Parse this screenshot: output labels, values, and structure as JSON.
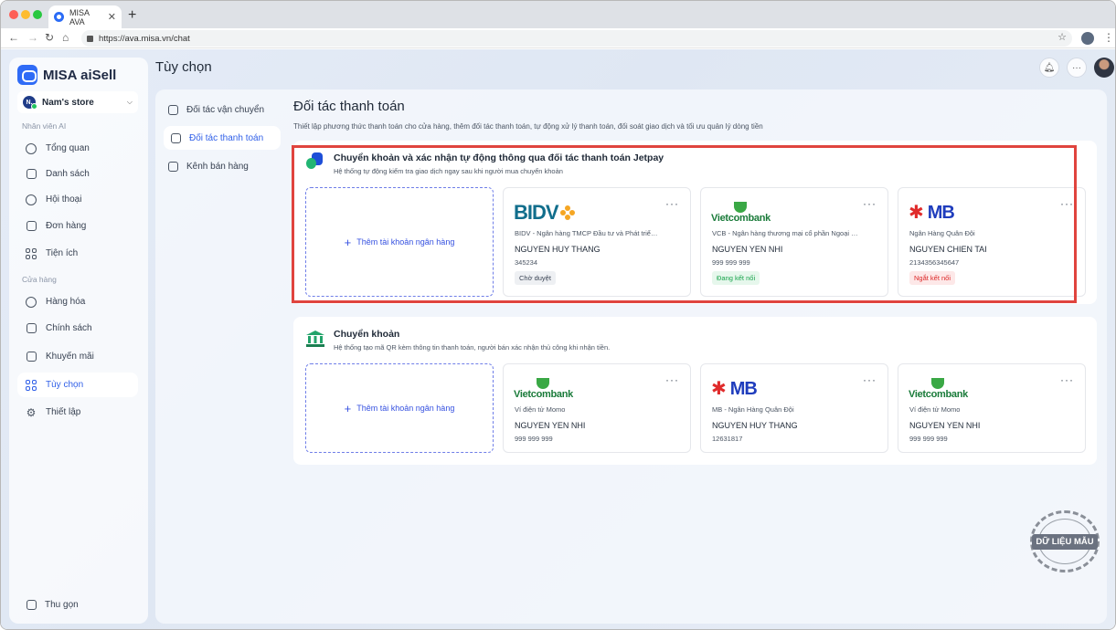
{
  "browser": {
    "tab_title": "MISA AVA",
    "tab_close": "✕",
    "new_tab": "+",
    "url": "https://ava.misa.vn/chat"
  },
  "brand": {
    "name": "MISA aiSell",
    "accent": "#2f6bf6"
  },
  "store": {
    "badge": "N.",
    "name": "Nam's store"
  },
  "sidebar": {
    "section_ai": "Nhân viên AI",
    "section_store": "Cửa hàng",
    "items": [
      {
        "label": "Tổng quan",
        "icon": "pie-chart-icon"
      },
      {
        "label": "Danh sách",
        "icon": "contacts-icon"
      },
      {
        "label": "Hội thoại",
        "icon": "chat-icon"
      },
      {
        "label": "Đơn hàng",
        "icon": "order-icon"
      },
      {
        "label": "Tiện ích",
        "icon": "apps-icon"
      },
      {
        "label": "Hàng hóa",
        "icon": "product-icon"
      },
      {
        "label": "Chính sách",
        "icon": "book-icon"
      },
      {
        "label": "Khuyến mãi",
        "icon": "gift-icon"
      },
      {
        "label": "Tùy chọn",
        "icon": "options-icon",
        "active": true
      },
      {
        "label": "Thiết lập",
        "icon": "gear-icon"
      }
    ],
    "collapse_label": "Thu gọn"
  },
  "header": {
    "title": "Tùy chọn"
  },
  "subnav": [
    {
      "label": "Đối tác vận chuyển",
      "icon": "truck-icon"
    },
    {
      "label": "Đối tác thanh toán",
      "icon": "card-icon",
      "active": true
    },
    {
      "label": "Kênh bán hàng",
      "icon": "store-icon"
    }
  ],
  "main": {
    "title": "Đối tác thanh toán",
    "subtitle": "Thiết lập phương thức thanh toán cho cửa hàng, thêm đối tác thanh toán, tự động xử lý thanh toán, đối soát giao dịch và tối ưu quản lý dòng tiền"
  },
  "jetpay": {
    "title": "Chuyển khoản và xác nhận tự động thông qua đối tác thanh toán Jetpay",
    "desc": "Hệ thống tự động kiểm tra giao dịch ngay sau khi người mua chuyển khoản",
    "add_label": "Thêm tài khoản ngân hàng",
    "accounts": [
      {
        "bank": "BIDV",
        "desc": "BIDV - Ngân hàng TMCP Đầu tư và Phát triển Việt Nam",
        "owner": "NGUYEN HUY THANG",
        "account": "345234",
        "status": "Chờ duyệt",
        "status_type": "pending"
      },
      {
        "bank": "Vietcombank",
        "desc": "VCB - Ngân hàng thương mại cổ phần Ngoại thương Việt Nam",
        "owner": "NGUYEN YEN NHI",
        "account": "999 999 999",
        "status": "Đang kết nối",
        "status_type": "ok"
      },
      {
        "bank": "MB",
        "desc": "Ngân Hàng Quân Đội",
        "owner": "NGUYEN CHIEN TAI",
        "account": "2134356345647",
        "status": "Ngắt kết nối",
        "status_type": "off"
      }
    ]
  },
  "transfer": {
    "title": "Chuyển khoản",
    "desc": "Hệ thống tạo mã QR kèm thông tin thanh toán, người bán xác nhận thủ công khi nhận tiền.",
    "add_label": "Thêm tài khoản ngân hàng",
    "accounts": [
      {
        "bank": "Vietcombank",
        "desc": "Ví điện tử Momo",
        "owner": "NGUYEN YEN NHI",
        "account": "999 999 999"
      },
      {
        "bank": "MB",
        "desc": "MB - Ngân Hàng Quân Đội",
        "owner": "NGUYEN HUY THANG",
        "account": "12631817"
      },
      {
        "bank": "Vietcombank",
        "desc": "Ví điện tử Momo",
        "owner": "NGUYEN YEN NHI",
        "account": "999 999 999"
      }
    ]
  },
  "more_label": "···",
  "watermark": "DỮ LIỆU MẪU"
}
